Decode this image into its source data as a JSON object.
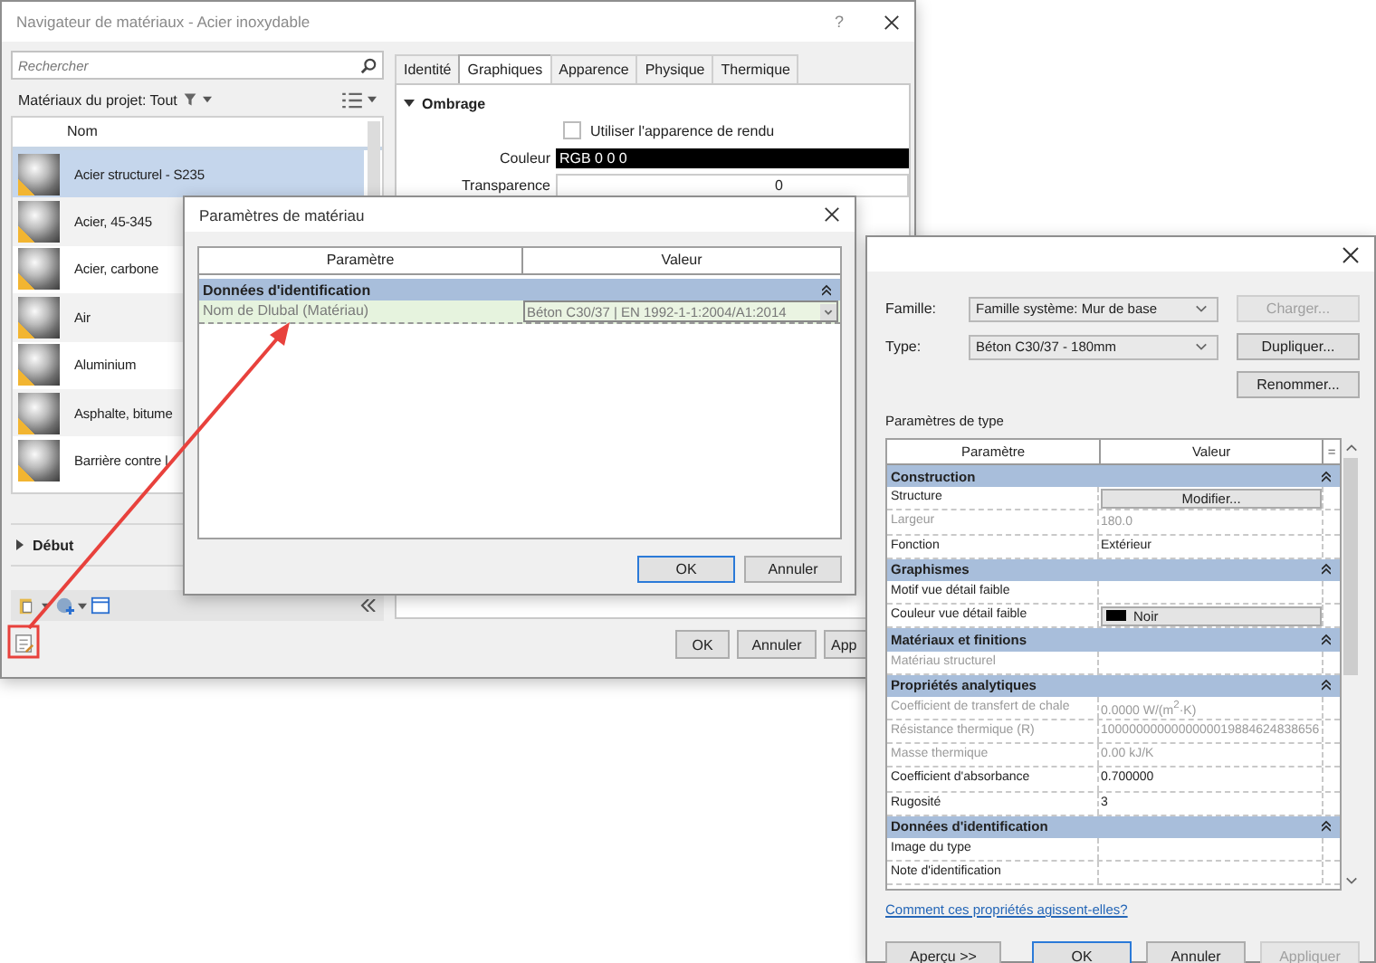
{
  "browser": {
    "title": "Navigateur de matériaux - Acier inoxydable",
    "help": "?",
    "search": {
      "placeholder": "Rechercher"
    },
    "filter": "Matériaux du projet: Tout",
    "list_header": "Nom",
    "materials": [
      {
        "name": "Acier structurel - S235",
        "selected": true
      },
      {
        "name": "Acier, 45-345",
        "selected": false
      },
      {
        "name": "Acier, carbone",
        "selected": false
      },
      {
        "name": "Air",
        "selected": false
      },
      {
        "name": "Aluminium",
        "selected": false
      },
      {
        "name": "Asphalte, bitume",
        "selected": false
      },
      {
        "name": "Barrière contre l",
        "selected": false
      }
    ],
    "section": "Début",
    "tabs": [
      {
        "label": "Identité",
        "selected": false
      },
      {
        "label": "Graphiques",
        "selected": true
      },
      {
        "label": "Apparence",
        "selected": false
      },
      {
        "label": "Physique",
        "selected": false
      },
      {
        "label": "Thermique",
        "selected": false
      }
    ],
    "shading": {
      "title": "Ombrage",
      "checkbox": {
        "label": "Utiliser l'apparence de rendu",
        "checked": false
      },
      "fields": [
        {
          "label": "Couleur",
          "value": "RGB 0 0 0",
          "kind": "color"
        },
        {
          "label": "Transparence",
          "value": "0",
          "kind": "number"
        }
      ]
    },
    "buttons": [
      "OK",
      "Annuler",
      "App"
    ]
  },
  "material_params": {
    "title": "Paramètres de matériau",
    "columns": [
      "Paramètre",
      "Valeur"
    ],
    "groups": [
      {
        "name": "Données d'identification",
        "expanded": true,
        "rows": [
          {
            "param": "Nom de Dlubal (Matériau)",
            "value": "Béton C30/37 | EN 1992-1-1:2004/A1:2014",
            "selected": true
          }
        ]
      }
    ],
    "buttons": [
      "OK",
      "Annuler"
    ]
  },
  "type_props": {
    "family": {
      "label": "Famille:",
      "value": "Famille système: Mur de base"
    },
    "type": {
      "label": "Type:",
      "value": "Béton C30/37 - 180mm"
    },
    "side_buttons": [
      {
        "label": "Charger...",
        "disabled": true
      },
      {
        "label": "Dupliquer...",
        "disabled": false
      },
      {
        "label": "Renommer...",
        "disabled": false
      }
    ],
    "table_title": "Paramètres de type",
    "columns": [
      "Paramètre",
      "Valeur",
      "="
    ],
    "groups": [
      {
        "name": "Construction",
        "expanded": true,
        "rows": [
          {
            "param": "Structure",
            "value": "Modifier...",
            "kind": "button",
            "disabled": false
          },
          {
            "param": "Largeur",
            "value": "180.0",
            "kind": "text",
            "disabled": true
          },
          {
            "param": "Fonction",
            "value": "Extérieur",
            "kind": "text",
            "disabled": false
          }
        ]
      },
      {
        "name": "Graphismes",
        "expanded": true,
        "rows": [
          {
            "param": "Motif vue détail faible",
            "kind": "text",
            "disabled": false
          },
          {
            "param": "Couleur vue détail faible",
            "value": "Noir",
            "kind": "swatch",
            "disabled": false
          }
        ]
      },
      {
        "name": "Matériaux et finitions",
        "expanded": true,
        "rows": [
          {
            "param": "Matériau structurel",
            "kind": "text",
            "disabled": true
          }
        ]
      },
      {
        "name": "Propriétés analytiques",
        "expanded": true,
        "rows": [
          {
            "param": "Coefficient de transfert de chale",
            "value": "0.0000 W/(m$^{2}$·K)",
            "kind": "text",
            "disabled": true
          },
          {
            "param": "Résistance thermique (R)",
            "value": "1000000000000000019884624838656",
            "kind": "text",
            "disabled": true
          },
          {
            "param": "Masse thermique",
            "value": "0.00 kJ/K",
            "kind": "text",
            "disabled": true
          },
          {
            "param": "Coefficient d'absorbance",
            "value": "0.700000",
            "kind": "text",
            "disabled": false
          },
          {
            "param": "Rugosité",
            "value": "3",
            "kind": "text",
            "disabled": false
          }
        ]
      },
      {
        "name": "Données d'identification",
        "expanded": true,
        "rows": [
          {
            "param": "Image du type",
            "kind": "text",
            "disabled": false
          },
          {
            "param": "Note d'identification",
            "kind": "text",
            "disabled": false
          }
        ]
      }
    ],
    "link": "Comment ces propriétés agissent-elles?",
    "buttons": [
      {
        "label": "Aperçu >>",
        "disabled": false,
        "default": false
      },
      {
        "label": "OK",
        "disabled": false,
        "default": true
      },
      {
        "label": "Annuler",
        "disabled": false,
        "default": false
      },
      {
        "label": "Appliquer",
        "disabled": true,
        "default": false
      }
    ]
  }
}
